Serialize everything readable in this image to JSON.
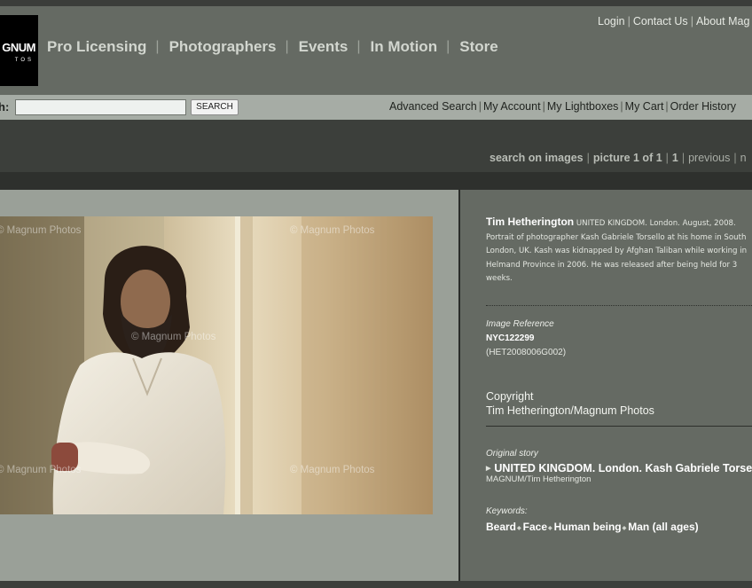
{
  "header": {
    "logo_line1": "GNUM",
    "logo_line2": "TOS",
    "main_nav": [
      "Pro Licensing",
      "Photographers",
      "Events",
      "In Motion",
      "Store"
    ],
    "util_nav": [
      "Login",
      "Contact Us",
      "About Mag"
    ]
  },
  "search": {
    "label": "h:",
    "value": "",
    "button": "SEARCH",
    "account_links": [
      "Advanced Search",
      "My Account",
      "My Lightboxes",
      "My Cart",
      "Order History"
    ]
  },
  "results": {
    "search_scope": "search on images",
    "picture_count": "picture 1 of 1",
    "page": "1",
    "previous": "previous",
    "next": "n"
  },
  "photo": {
    "watermark": "© Magnum Photos"
  },
  "details": {
    "photographer": "Tim Hetherington",
    "caption": "UNITED KINGDOM. London. August, 2008. Portrait of photographer Kash Gabriele Torsello at his home in South London, UK. Kash was kidnapped by Afghan Taliban while working in Helmand Province in 2006. He was released after being held for 3 weeks.",
    "image_ref_label": "Image Reference",
    "image_ref": "NYC122299",
    "image_ref_alt": "(HET2008006G002)",
    "copyright_label": "Copyright",
    "copyright": "Tim Hetherington/Magnum Photos",
    "story_label": "Original story",
    "story_title": "UNITED KINGDOM. London. Kash Gabriele Torsello",
    "story_credit": "MAGNUM/Tim Hetherington",
    "keywords_label": "Keywords:",
    "keywords": [
      "Beard",
      "Face",
      "Human being",
      "Man (all ages)"
    ]
  },
  "colors": {
    "header_bg": "#656a63",
    "search_bar_bg": "#a6aca5",
    "left_panel_bg": "#9aa098",
    "right_panel_bg": "#656a63"
  }
}
